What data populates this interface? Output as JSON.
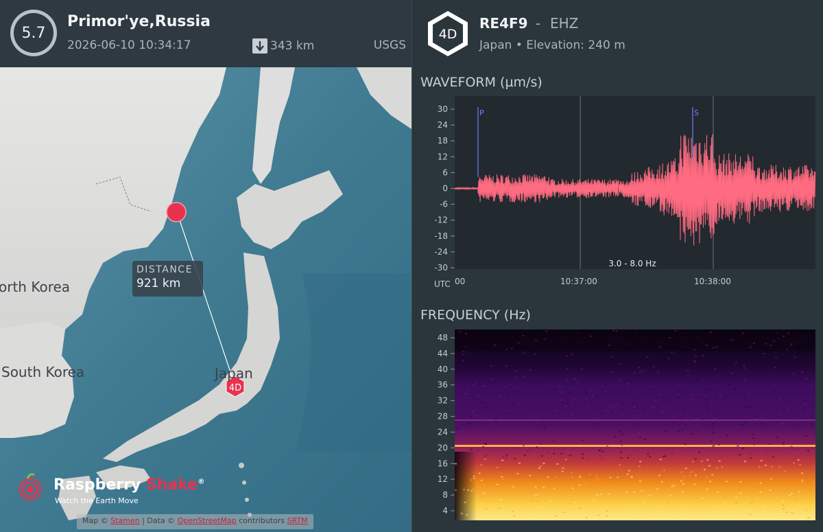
{
  "earthquake": {
    "magnitude": "5.7",
    "title": "Primor'ye,Russia",
    "datetime": "2026-06-10 10:34:17",
    "depth": "343 km",
    "source": "USGS"
  },
  "map": {
    "labels": {
      "north_korea": "orth Korea",
      "south_korea": "South Korea",
      "japan": "Japan"
    },
    "station_marker": "4D",
    "distance_label": "DISTANCE",
    "distance_value": "921 km",
    "attribution": {
      "prefix": "Map ©",
      "link1": "Stamen",
      "mid": "| Data ©",
      "link2": "OpenStreetMap",
      "suffix": "contributors",
      "link3": "SRTM"
    }
  },
  "brand": {
    "name_white": "Raspberry",
    "name_pink": "Shake",
    "registered": "®",
    "tagline": "Watch the Earth Move"
  },
  "station": {
    "badge": "4D",
    "name": "RE4F9",
    "separator": "-",
    "channel": "EHZ",
    "location": "Japan • Elevation: 240 m"
  },
  "waveform": {
    "title": "WAVEFORM (µm/s)",
    "y_ticks": [
      "30",
      "24",
      "18",
      "12",
      "6",
      "0",
      "-6",
      "-12",
      "-18",
      "-24",
      "-30"
    ],
    "x_ticks": [
      "00",
      "10:37:00",
      "10:38:00"
    ],
    "utc_label": "UTC",
    "filter_label": "3.0 - 8.0 Hz",
    "p_label": "P",
    "s_label": "S",
    "trace_color": "#ff6b81"
  },
  "frequency": {
    "title": "FREQUENCY (Hz)",
    "y_ticks": [
      "48",
      "44",
      "40",
      "36",
      "32",
      "28",
      "24",
      "20",
      "16",
      "12",
      "8",
      "4"
    ]
  },
  "colors": {
    "accent": "#e8324e",
    "panel": "#2b353c",
    "water": "#4a8499"
  }
}
